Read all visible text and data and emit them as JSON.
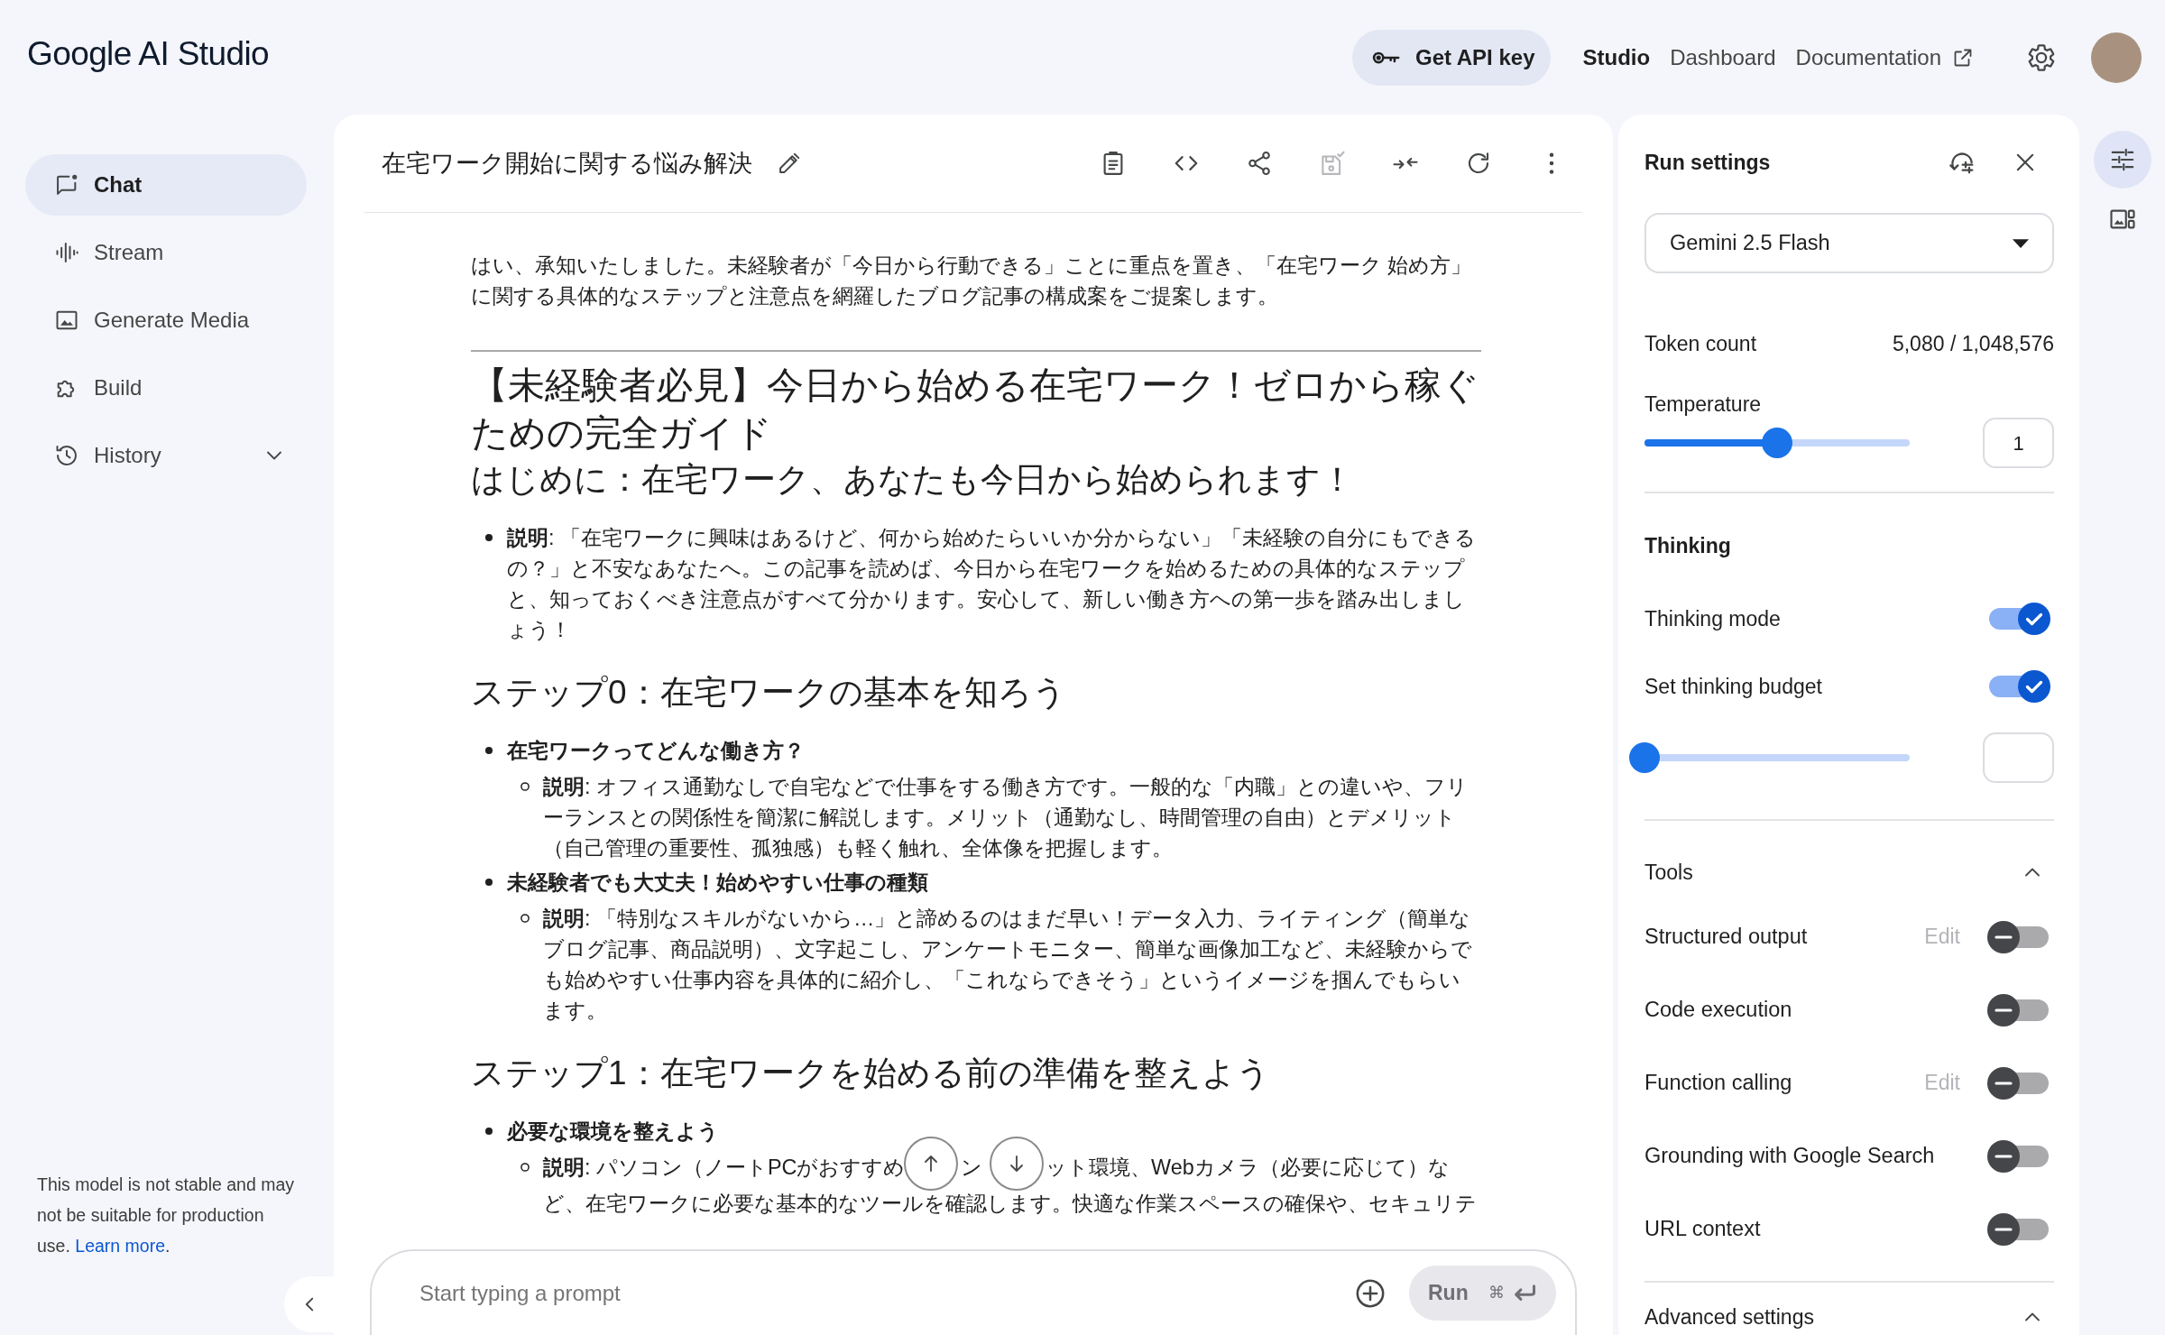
{
  "header": {
    "logo": "Google AI Studio",
    "api_key_button": "Get API key",
    "nav": [
      {
        "label": "Studio",
        "selected": true,
        "external": false
      },
      {
        "label": "Dashboard",
        "selected": false,
        "external": false
      },
      {
        "label": "Documentation",
        "selected": false,
        "external": true
      }
    ]
  },
  "sidebar": {
    "items": [
      {
        "label": "Chat",
        "selected": true
      },
      {
        "label": "Stream",
        "selected": false
      },
      {
        "label": "Generate Media",
        "selected": false
      },
      {
        "label": "Build",
        "selected": false
      },
      {
        "label": "History",
        "selected": false,
        "expanded": false
      }
    ],
    "note": {
      "text": "This model is not stable and may not be suitable for production use.",
      "link": "Learn more",
      "suffix": "."
    }
  },
  "chat": {
    "title": "在宅ワーク開始に関する悩み解決",
    "intro": "はい、承知いたしました。未経験者が「今日から行動できる」ことに重点を置き、「在宅ワーク 始め方」に関する具体的なステップと注意点を網羅したブログ記事の構成案をご提案します。",
    "blocks": [
      {
        "kind": "title",
        "text": "【未経験者必見】今日から始める在宅ワーク！ゼロから稼ぐための完全ガイド"
      },
      {
        "kind": "heading",
        "text": "はじめに：在宅ワーク、あなたも今日から始められます！"
      },
      {
        "kind": "list",
        "items": [
          {
            "kind": "detail",
            "text": "**説明**: 「在宅ワークに興味はあるけど、何から始めたらいいか分からない」「未経験の自分にもできるの？」と不安なあなたへ。この記事を読めば、今日から在宅ワークを始めるための具体的なステップと、知っておくべき注意点がすべて分かります。安心して、新しい働き方への第一歩を踏み出しましょう！"
          }
        ]
      },
      {
        "kind": "heading",
        "text": "ステップ0：在宅ワークの基本を知ろう"
      },
      {
        "kind": "list",
        "items": [
          {
            "kind": "topic",
            "text": "在宅ワークってどんな働き方？",
            "children": [
              {
                "kind": "detail",
                "text": "**説明**: オフィス通勤なしで自宅などで仕事をする働き方です。一般的な「内職」との違いや、フリーランスとの関係性を簡潔に解説します。メリット（通勤なし、時間管理の自由）とデメリット（自己管理の重要性、孤独感）も軽く触れ、全体像を把握します。"
              }
            ]
          },
          {
            "kind": "topic",
            "text": "未経験者でも大丈夫！始めやすい仕事の種類",
            "children": [
              {
                "kind": "detail",
                "text": "**説明**: 「特別なスキルがないから…」と諦めるのはまだ早い！データ入力、ライティング（簡単なブログ記事、商品説明）、文字起こし、アンケートモニター、簡単な画像加工など、未経験からでも始めやすい仕事内容を具体的に紹介し、「これならできそう」というイメージを掴んでもらいます。"
              }
            ]
          }
        ]
      },
      {
        "kind": "heading",
        "text": "ステップ1：在宅ワークを始める前の準備を整えよう"
      },
      {
        "kind": "list",
        "items": [
          {
            "kind": "topic",
            "text": "必要な環境を整えよう",
            "children": [
              {
                "kind": "covered",
                "lines": [
                  [
                    "**説明**: パソコン（ノートPCがおすすめ",
                    "ン",
                    "ット環境、Webカメラ（必要に応じて）な"
                  ],
                  [
                    "ど、在宅ワークに必要な基本的なツールを確認します。快適な作業スペースの確保や、セキュリテ"
                  ]
                ]
              }
            ]
          }
        ]
      }
    ],
    "prompt": {
      "placeholder": "Start typing a prompt"
    },
    "run_button": {
      "label": "Run",
      "shortcut": "⌘",
      "disabled": true
    }
  },
  "run_settings": {
    "title": "Run settings",
    "model": "Gemini 2.5 Flash",
    "token_count": {
      "label": "Token count",
      "value": "5,080 / 1,048,576"
    },
    "temperature": {
      "label": "Temperature",
      "level": 0.5,
      "value": "1"
    },
    "thinking": {
      "title": "Thinking",
      "toggles": [
        {
          "label": "Thinking mode",
          "on": true
        },
        {
          "label": "Set thinking budget",
          "on": true
        }
      ],
      "budget": {
        "level": 0
      }
    },
    "tools": {
      "title": "Tools",
      "expanded": true,
      "items": [
        {
          "label": "Structured output",
          "edit": "Edit",
          "on": false
        },
        {
          "label": "Code execution",
          "on": false
        },
        {
          "label": "Function calling",
          "edit": "Edit",
          "on": false
        },
        {
          "label": "Grounding with Google Search",
          "on": false
        },
        {
          "label": "URL context",
          "on": false
        }
      ]
    },
    "advanced": {
      "title": "Advanced settings",
      "expanded": true
    }
  },
  "right_rail": {
    "buttons": [
      {
        "selected": true
      },
      {
        "selected": false
      }
    ]
  }
}
